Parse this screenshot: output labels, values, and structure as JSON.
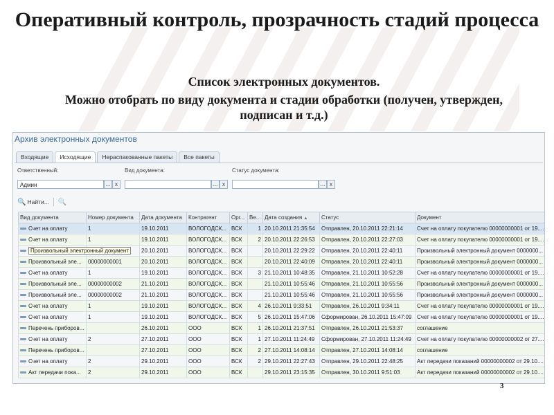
{
  "slide": {
    "title": "Оперативный контроль, прозрачность стадий процесса",
    "subtitle_line1": "Список электронных документов.",
    "subtitle_line2": "Можно отобрать по виду документа и стадии обработки (получен, утвержден, подписан и т.д.)",
    "page_number": "3"
  },
  "window": {
    "title": "Архив электронных документов",
    "tabs": [
      "Входящие",
      "Исходящие",
      "Нераспакованные пакеты",
      "Все пакеты"
    ],
    "active_tab": "Исходящие",
    "filters": {
      "responsible_label": "Ответственный:",
      "responsible_value": "Админ",
      "doc_type_label": "Вид документа:",
      "doc_type_value": "",
      "status_label": "Статус документа:",
      "status_value": "",
      "select_button": "...",
      "clear_button": "x"
    },
    "toolbar": {
      "find_label": "Найти...",
      "find_icon": "search-icon",
      "cancel_find_icon": "cancel-search-icon"
    },
    "table": {
      "columns": [
        "Вид документа",
        "Номер документа",
        "Дата документа",
        "Контрагент",
        "Орг...",
        "Ве...",
        "Дата создания",
        "Статус",
        "Документ"
      ],
      "sort_indicator": "▲",
      "tooltip": "Произвольный электронный документ",
      "rows": [
        {
          "type": "Счет на оплату",
          "number": "1",
          "date": "19.10.2011",
          "agent": "ВОЛОГОДСК...",
          "org": "ВСК",
          "ver": "1",
          "created": "20.10.2011 21:35:54",
          "status": "Отправлен, 20.10.2011 22:21:14",
          "doc": "Счет на оплату покупателю 00000000001 от 19...."
        },
        {
          "type": "Счет на оплату",
          "number": "1",
          "date": "19.10.2011",
          "agent": "ВОЛОГОДСК...",
          "org": "ВСК",
          "ver": "2",
          "created": "20.10.2011 22:26:53",
          "status": "Отправлен, 20.10.2011 22:27:03",
          "doc": "Счет на оплату покупателю 00000000001 от 19...."
        },
        {
          "type": "Произвольный электронный документ",
          "number": "",
          "date": "20.10.2011",
          "agent": "ВОЛОГОДСК...",
          "org": "ВСК",
          "ver": "",
          "created": "20.10.2011 22:29:22",
          "status": "Отправлен, 20.10.2011 22:40:11",
          "doc": "Произвольный электронный документ 0000000..."
        },
        {
          "type": "Произвольный эле...",
          "number": "00000000001",
          "date": "20.10.2011",
          "agent": "ВОЛОГОДСК...",
          "org": "ВСК",
          "ver": "",
          "created": "20.10.2011 22:40:09",
          "status": "Отправлен, 20.10.2011 22:40:11",
          "doc": "Произвольный электронный документ 0000000..."
        },
        {
          "type": "Счет на оплату",
          "number": "1",
          "date": "19.10.2011",
          "agent": "ВОЛОГОДСК...",
          "org": "ВСК",
          "ver": "3",
          "created": "21.10.2011 10:48:35",
          "status": "Отправлен, 21.10.2011 10:52:28",
          "doc": "Счет на оплату покупателю 00000000001 от 19...."
        },
        {
          "type": "Произвольный эле...",
          "number": "00000000002",
          "date": "21.10.2011",
          "agent": "ВОЛОГОДСК...",
          "org": "ВСК",
          "ver": "",
          "created": "21.10.2011 10:55:46",
          "status": "Отправлен, 21.10.2011 10:55:56",
          "doc": "Произвольный электронный документ 0000000..."
        },
        {
          "type": "Произвольный эле...",
          "number": "00000000002",
          "date": "21.10.2011",
          "agent": "ВОЛОГОДСК...",
          "org": "ВСК",
          "ver": "",
          "created": "21.10.2011 10:55:46",
          "status": "Отправлен, 21.10.2011 10:55:56",
          "doc": "Произвольный электронный документ 0000000..."
        },
        {
          "type": "Счет на оплату",
          "number": "1",
          "date": "19.10.2011",
          "agent": "ВОЛОГОДСК...",
          "org": "ВСК",
          "ver": "4",
          "created": "26.10.2011 9:33:51",
          "status": "Отправлен, 26.10.2011 9:34:11",
          "doc": "Счет на оплату покупателю 00000000001 от 19...."
        },
        {
          "type": "Счет на оплату",
          "number": "1",
          "date": "19.10.2011",
          "agent": "ВОЛОГОДСК...",
          "org": "ВСК",
          "ver": "5",
          "created": "26.10.2011 15:47:06",
          "status": "Сформирован, 26.10.2011 15:47:09",
          "doc": "Счет на оплату покупателю 00000000001 от 19...."
        },
        {
          "type": "Перечень приборов...",
          "number": "",
          "date": "26.10.2011",
          "agent": "ООО",
          "org": "ВСК",
          "ver": "1",
          "created": "26.10.2011 21:37:51",
          "status": "Отправлен, 26.10.2011 21:53:37",
          "doc": "соглашение"
        },
        {
          "type": "Счет на оплату",
          "number": "2",
          "date": "27.10.2011",
          "agent": "ООО",
          "org": "ВСК",
          "ver": "1",
          "created": "27.10.2011 11:24:49",
          "status": "Сформирован, 27.10.2011 11:24:49",
          "doc": "Счет на оплату покупателю 00000000002 от 27...."
        },
        {
          "type": "Перечень приборов...",
          "number": "",
          "date": "27.10.2011",
          "agent": "ООО",
          "org": "ВСК",
          "ver": "2",
          "created": "27.10.2011 14:08:14",
          "status": "Отправлен, 27.10.2011 14:08:14",
          "doc": "соглашение"
        },
        {
          "type": "Счет на оплату",
          "number": "2",
          "date": "29.10.2011",
          "agent": "ООО",
          "org": "ВСК",
          "ver": "2",
          "created": "29.10.2011 22:27:43",
          "status": "Отправлен, 29.10.2011 22:48:25",
          "doc": "Акт передачи показаний 00000000002 от 29.10...."
        },
        {
          "type": "Акт передачи пока...",
          "number": "2",
          "date": "29.10.2011",
          "agent": "ООО",
          "org": "ВСК",
          "ver": "",
          "created": "29.10.2011 23:15:35",
          "status": "Отправлен, 30.10.2011 9:51:03",
          "doc": "Акт передачи показаний 00000000002 от 29.10...."
        }
      ]
    }
  }
}
